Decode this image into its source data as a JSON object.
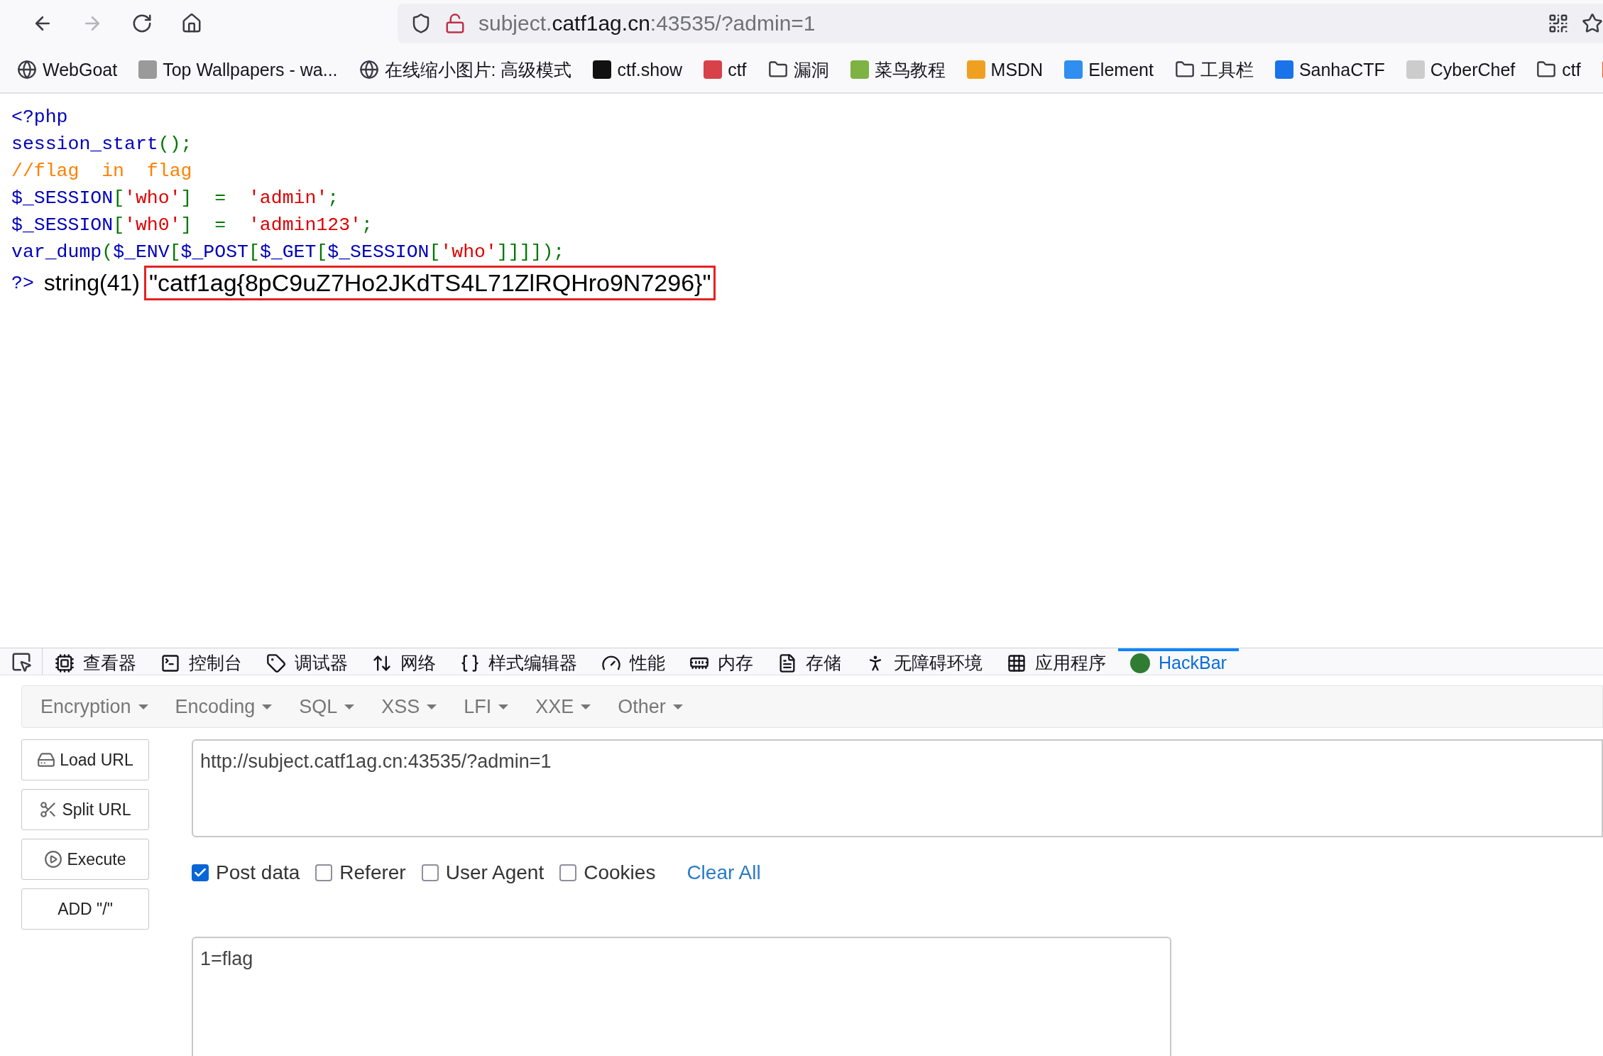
{
  "browser": {
    "nav": [
      {
        "kind": "back",
        "disabled": false
      },
      {
        "kind": "forward",
        "disabled": true
      },
      {
        "kind": "reload",
        "disabled": false
      },
      {
        "kind": "home",
        "disabled": false
      }
    ],
    "address": {
      "prefix": "subject.",
      "host": "catf1ag.cn",
      "rest": ":43535/?admin=1"
    },
    "bookmarks": [
      {
        "kind": "globe",
        "label": "WebGoat"
      },
      {
        "kind": "favicon",
        "color": "#9a9a9a",
        "label": "Top Wallpapers - wa..."
      },
      {
        "kind": "globe",
        "label": "在线缩小图片: 高级模式"
      },
      {
        "kind": "favicon",
        "color": "#111111",
        "label": "ctf.show"
      },
      {
        "kind": "favicon",
        "color": "#d8404a",
        "label": "ctf"
      },
      {
        "kind": "folder",
        "label": "漏洞"
      },
      {
        "kind": "favicon",
        "color": "#7cb342",
        "label": "菜鸟教程"
      },
      {
        "kind": "favicon",
        "color": "#f0a020",
        "label": "MSDN"
      },
      {
        "kind": "favicon",
        "color": "#2f8ef0",
        "label": "Element"
      },
      {
        "kind": "folder",
        "label": "工具栏"
      },
      {
        "kind": "favicon",
        "color": "#1a73e8",
        "label": "SanhaCTF"
      },
      {
        "kind": "favicon",
        "color": "#cccccc",
        "label": "CyberChef"
      },
      {
        "kind": "folder",
        "label": "ctf"
      },
      {
        "kind": "favicon",
        "color": "#f4511e"
      }
    ]
  },
  "source": [
    [
      {
        "kind": "ident",
        "text": "<?php"
      }
    ],
    [
      {
        "kind": "ident",
        "text": "session_start"
      },
      {
        "kind": "punct",
        "text": "();"
      }
    ],
    [
      {
        "kind": "comment",
        "text": "//flag  in  flag"
      }
    ],
    [
      {
        "kind": "ident",
        "text": "$_SESSION"
      },
      {
        "kind": "punct",
        "text": "["
      },
      {
        "kind": "string",
        "text": "'who'"
      },
      {
        "kind": "punct",
        "text": "]  =  "
      },
      {
        "kind": "string",
        "text": "'admin'"
      },
      {
        "kind": "punct",
        "text": ";"
      }
    ],
    [
      {
        "kind": "ident",
        "text": "$_SESSION"
      },
      {
        "kind": "punct",
        "text": "["
      },
      {
        "kind": "string",
        "text": "'wh0'"
      },
      {
        "kind": "punct",
        "text": "]  =  "
      },
      {
        "kind": "string",
        "text": "'admin123'"
      },
      {
        "kind": "punct",
        "text": ";"
      }
    ],
    [
      {
        "kind": "ident",
        "text": "var_dump"
      },
      {
        "kind": "punct",
        "text": "("
      },
      {
        "kind": "ident",
        "text": "$_ENV"
      },
      {
        "kind": "punct",
        "text": "["
      },
      {
        "kind": "ident",
        "text": "$_POST"
      },
      {
        "kind": "punct",
        "text": "["
      },
      {
        "kind": "ident",
        "text": "$_GET"
      },
      {
        "kind": "punct",
        "text": "["
      },
      {
        "kind": "ident",
        "text": "$_SESSION"
      },
      {
        "kind": "punct",
        "text": "["
      },
      {
        "kind": "string",
        "text": "'who'"
      },
      {
        "kind": "punct",
        "text": "]]]]);"
      }
    ]
  ],
  "closing_tag": "?>",
  "output": {
    "type": "string(41)",
    "value": "\"catf1ag{8pC9uZ7Ho2JKdTS4L71ZlRQHro9N7296}\"",
    "highlighted": true
  },
  "devtools": {
    "tabs": [
      {
        "label": "查看器",
        "selected": false
      },
      {
        "label": "控制台",
        "selected": false
      },
      {
        "label": "调试器",
        "selected": false
      },
      {
        "label": "网络",
        "selected": false
      },
      {
        "label": "样式编辑器",
        "selected": false
      },
      {
        "label": "性能",
        "selected": false
      },
      {
        "label": "内存",
        "selected": false
      },
      {
        "label": "存储",
        "selected": false
      },
      {
        "label": "无障碍环境",
        "selected": false
      },
      {
        "label": "应用程序",
        "selected": false
      },
      {
        "label": "HackBar",
        "selected": true
      }
    ]
  },
  "hackbar": {
    "menus": [
      "Encryption",
      "Encoding",
      "SQL",
      "XSS",
      "LFI",
      "XXE",
      "Other"
    ],
    "buttons": [
      {
        "kind": "load",
        "label": "Load URL"
      },
      {
        "kind": "split",
        "label": "Split URL"
      },
      {
        "kind": "execute",
        "label": "Execute"
      },
      {
        "kind": "plain",
        "label": "ADD \"/\""
      }
    ],
    "url": "http://subject.catf1ag.cn:43535/?admin=1",
    "options": [
      {
        "label": "Post data",
        "checked": true
      },
      {
        "label": "Referer",
        "checked": false
      },
      {
        "label": "User Agent",
        "checked": false
      },
      {
        "label": "Cookies",
        "checked": false
      }
    ],
    "clear_all": "Clear All",
    "post_body": "1=flag"
  }
}
